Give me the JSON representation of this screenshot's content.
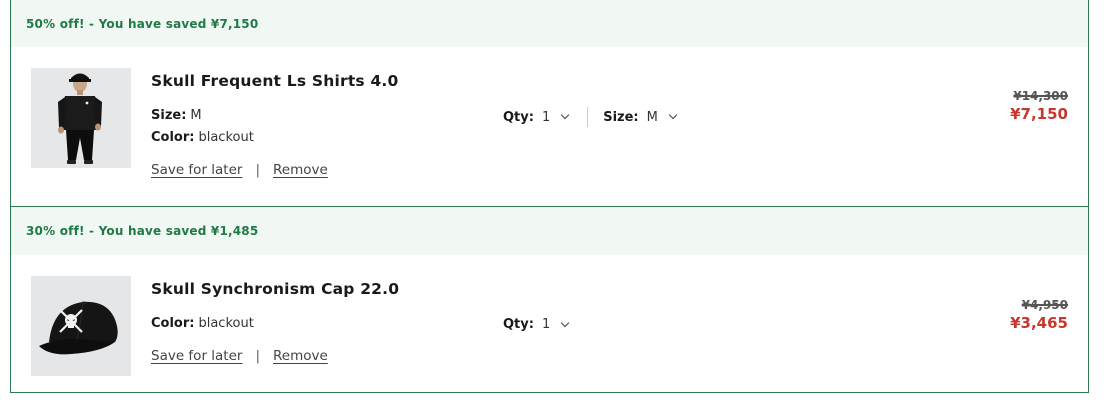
{
  "items": [
    {
      "promo": "50% off! - You have saved ¥7,150",
      "title": "Skull Frequent Ls Shirts 4.0",
      "size_label": "Size:",
      "size_value": "M",
      "color_label": "Color:",
      "color_value": "blackout",
      "save_for_later": "Save for later",
      "separator": "|",
      "remove": "Remove",
      "qty_label": "Qty:",
      "qty_value": "1",
      "size_select_label": "Size:",
      "size_select_value": "M",
      "price_original": "¥14,300",
      "price_sale": "¥7,150",
      "image_icon": "shirt-model-photo"
    },
    {
      "promo": "30% off! - You have saved ¥1,485",
      "title": "Skull Synchronism Cap 22.0",
      "color_label": "Color:",
      "color_value": "blackout",
      "save_for_later": "Save for later",
      "separator": "|",
      "remove": "Remove",
      "qty_label": "Qty:",
      "qty_value": "1",
      "price_original": "¥4,950",
      "price_sale": "¥3,465",
      "image_icon": "black-cap-photo"
    }
  ],
  "colors": {
    "border": "#2f7a52",
    "promo_bg": "#f1f8f4",
    "promo_text": "#1f7a45",
    "sale_price": "#c8362e"
  }
}
